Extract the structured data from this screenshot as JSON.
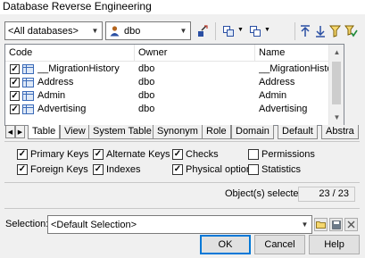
{
  "window": {
    "title": "Database Reverse Engineering"
  },
  "toolbar": {
    "database_combo": {
      "value": "<All databases>"
    },
    "owner_combo": {
      "value": "dbo",
      "icon": "user-icon"
    }
  },
  "table_list": {
    "columns": [
      "Code",
      "Owner",
      "Name"
    ],
    "rows": [
      {
        "checked": true,
        "code": "__MigrationHistory",
        "owner": "dbo",
        "name": "__MigrationHistory"
      },
      {
        "checked": true,
        "code": "Address",
        "owner": "dbo",
        "name": "Address"
      },
      {
        "checked": true,
        "code": "Admin",
        "owner": "dbo",
        "name": "Admin"
      },
      {
        "checked": true,
        "code": "Advertising",
        "owner": "dbo",
        "name": "Advertising"
      }
    ]
  },
  "tabs": [
    "Table",
    "View",
    "System Table",
    "Synonym",
    "Role",
    "Domain",
    "Default",
    "Abstra"
  ],
  "active_tab": "Table",
  "options": {
    "primary_keys": {
      "label": "Primary Keys",
      "checked": true
    },
    "alternate_keys": {
      "label": "Alternate Keys",
      "checked": true
    },
    "checks": {
      "label": "Checks",
      "checked": true
    },
    "permissions": {
      "label": "Permissions",
      "checked": false
    },
    "foreign_keys": {
      "label": "Foreign Keys",
      "checked": true
    },
    "indexes": {
      "label": "Indexes",
      "checked": true
    },
    "physical_options": {
      "label": "Physical options",
      "checked": true
    },
    "statistics": {
      "label": "Statistics",
      "checked": false
    }
  },
  "selection_status": {
    "label": "Object(s) selected:",
    "value": "23 / 23"
  },
  "selection": {
    "label": "Selection:",
    "value": "<Default Selection>"
  },
  "buttons": {
    "ok": "OK",
    "cancel": "Cancel",
    "help": "Help"
  },
  "colors": {
    "accent": "#0078d7",
    "table_icon": "#3a6ab8"
  }
}
